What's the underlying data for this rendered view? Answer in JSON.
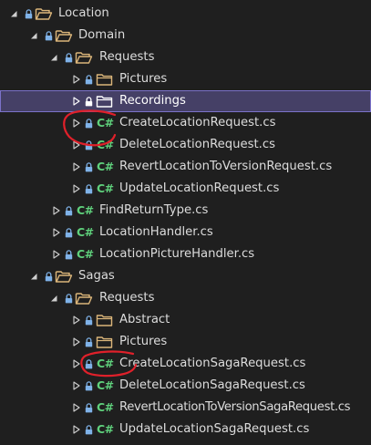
{
  "tree": {
    "rows": [
      {
        "label": "Location",
        "icon": "folder-open-icon",
        "expanded": true
      },
      {
        "label": "Domain",
        "icon": "folder-open-icon",
        "expanded": true
      },
      {
        "label": "Requests",
        "icon": "folder-open-icon",
        "expanded": true
      },
      {
        "label": "Pictures",
        "icon": "folder-icon",
        "expanded": false
      },
      {
        "label": "Recordings",
        "icon": "folder-icon",
        "expanded": false,
        "selected": true
      },
      {
        "label": "CreateLocationRequest.cs",
        "icon": "csharp-file-icon",
        "icon_text": "C#",
        "expanded": false
      },
      {
        "label": "DeleteLocationRequest.cs",
        "icon": "csharp-file-icon",
        "icon_text": "C#",
        "expanded": false
      },
      {
        "label": "RevertLocationToVersionRequest.cs",
        "icon": "csharp-file-icon",
        "icon_text": "C#",
        "expanded": false
      },
      {
        "label": "UpdateLocationRequest.cs",
        "icon": "csharp-file-icon",
        "icon_text": "C#",
        "expanded": false
      },
      {
        "label": "FindReturnType.cs",
        "icon": "csharp-file-icon",
        "icon_text": "C#",
        "expanded": false
      },
      {
        "label": "LocationHandler.cs",
        "icon": "csharp-file-icon",
        "icon_text": "C#",
        "expanded": false
      },
      {
        "label": "LocationPictureHandler.cs",
        "icon": "csharp-file-icon",
        "icon_text": "C#",
        "expanded": false
      },
      {
        "label": "Sagas",
        "icon": "folder-open-icon",
        "expanded": true
      },
      {
        "label": "Requests",
        "icon": "folder-open-icon",
        "expanded": true
      },
      {
        "label": "Abstract",
        "icon": "folder-icon",
        "expanded": false
      },
      {
        "label": "Pictures",
        "icon": "folder-icon",
        "expanded": false
      },
      {
        "label": "CreateLocationSagaRequest.cs",
        "icon": "csharp-file-icon",
        "icon_text": "C#",
        "expanded": false
      },
      {
        "label": "DeleteLocationSagaRequest.cs",
        "icon": "csharp-file-icon",
        "icon_text": "C#",
        "expanded": false
      },
      {
        "label": "RevertLocationToVersionSagaRequest.cs",
        "icon": "csharp-file-icon",
        "icon_text": "C#",
        "expanded": false
      },
      {
        "label": "UpdateLocationSagaRequest.cs",
        "icon": "csharp-file-icon",
        "icon_text": "C#",
        "expanded": false
      }
    ]
  },
  "colors": {
    "background": "#1f1f1f",
    "selection": "#454066",
    "selection_border": "#7b72c9",
    "folder": "#dcb67a",
    "lock": "#7fb2e8",
    "csharp": "#5fd17c",
    "annotation": "#e0202a"
  }
}
